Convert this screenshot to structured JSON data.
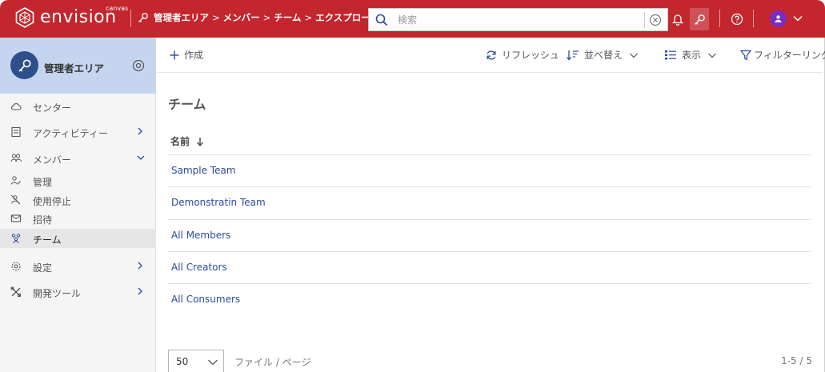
{
  "header": {
    "logo_text": "envision",
    "logo_sub": "canvas",
    "breadcrumb": [
      {
        "label": "管理者エリア"
      },
      {
        "label": "メンバー"
      },
      {
        "label": "チーム"
      },
      {
        "label": "エクスプローラー"
      }
    ],
    "search": {
      "placeholder": "検索",
      "value": ""
    },
    "icons": [
      "bell-icon",
      "key-icon",
      "help-icon",
      "user-avatar",
      "chevron-down-icon"
    ]
  },
  "sidebar": {
    "header_title": "管理者エリア",
    "items": [
      {
        "label": "センター",
        "icon": "cloud-icon"
      },
      {
        "label": "アクティビティー",
        "icon": "activity-icon",
        "arrow": "right"
      },
      {
        "label": "メンバー",
        "icon": "members-icon",
        "arrow": "down"
      },
      {
        "label": "管理",
        "icon": "user-edit-icon"
      },
      {
        "label": "使用停止",
        "icon": "user-disabled-icon"
      },
      {
        "label": "招待",
        "icon": "mail-icon"
      },
      {
        "label": "チーム",
        "icon": "team-icon",
        "active": true
      },
      {
        "label": "設定",
        "icon": "gear-icon",
        "arrow": "right"
      },
      {
        "label": "開発ツール",
        "icon": "tools-icon",
        "arrow": "right"
      }
    ]
  },
  "toolbar": {
    "create": "作成",
    "refresh": "リフレッシュ",
    "sort": "並べ替え",
    "view": "表示",
    "filter": "フィルターリング"
  },
  "main": {
    "title": "チーム",
    "column_header": "名前",
    "rows": [
      "Sample Team",
      "Demonstratin Team",
      "All Members",
      "All Creators",
      "All Consumers"
    ]
  },
  "pager": {
    "page_size": "50",
    "label": "ファイル / ページ",
    "count": "1-5 / 5"
  },
  "colors": {
    "header_bg": "#c4262e",
    "sidebar_head_bg": "#c5d5ef",
    "link": "#2b4a9e",
    "avatar": "#7b2bbf"
  }
}
